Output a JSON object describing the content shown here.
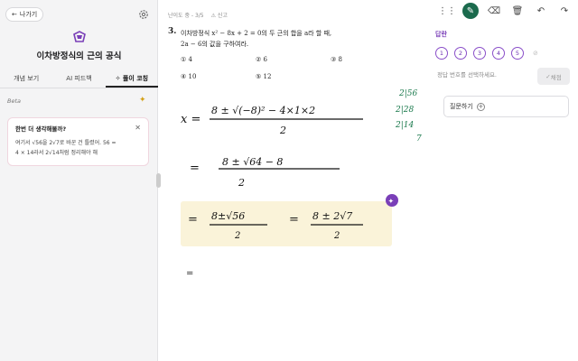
{
  "header": {
    "back_label": "나가기",
    "lesson_title": "이차방정식의 근의 공식"
  },
  "tabs": [
    {
      "label": "개념 보기"
    },
    {
      "label": "AI 피드백"
    },
    {
      "label": "풀이 코칭"
    }
  ],
  "panel": {
    "beta": "Beta"
  },
  "card": {
    "title": "한번 더 생각해볼까?",
    "line1": "여기서 √56을 2√7로 바꾼 건 틀렸어. 56 =",
    "line2": "4 × 14라서 2√14처럼 정리해야 해"
  },
  "question": {
    "meta_difficulty": "난이도 중 - 3/5",
    "meta_report": "신고",
    "number": "3.",
    "line1": "이차방정식  x² − 8x + 2 = 0의 두 근의 합을 a라 할 때,",
    "line2": "2a − 6의 값을 구하여라.",
    "choices": [
      "① 4",
      "② 6",
      "③ 8",
      "④ 10",
      "⑤ 12"
    ]
  },
  "answer": {
    "label": "답란",
    "choices": [
      "1",
      "2",
      "3",
      "4",
      "5"
    ],
    "hint": "정답 번호를 선택하세요.",
    "grade_label": "채점"
  },
  "ask": {
    "label": "질문하기"
  },
  "handwriting": {
    "line1_lhs": "x =",
    "line1_num": "8 ± √(−8)² − 4×1×2",
    "line1_den": "2",
    "line2_lhs": "=",
    "line2_num": "8 ± √64 − 8",
    "line2_den": "2",
    "line3_lhs": "=",
    "line3a_num": "8±√56",
    "line3a_den": "2",
    "line3b_eq": "=",
    "line3b_num": "8 ± 2√7",
    "line3b_den": "2",
    "line4": "=",
    "factor_rows": [
      "2|56",
      "2|28",
      "2|14",
      "7"
    ]
  },
  "colors": {
    "accent": "#7a3fb8",
    "pen": "#1b6a4d",
    "highlight": "#faf3d9"
  }
}
